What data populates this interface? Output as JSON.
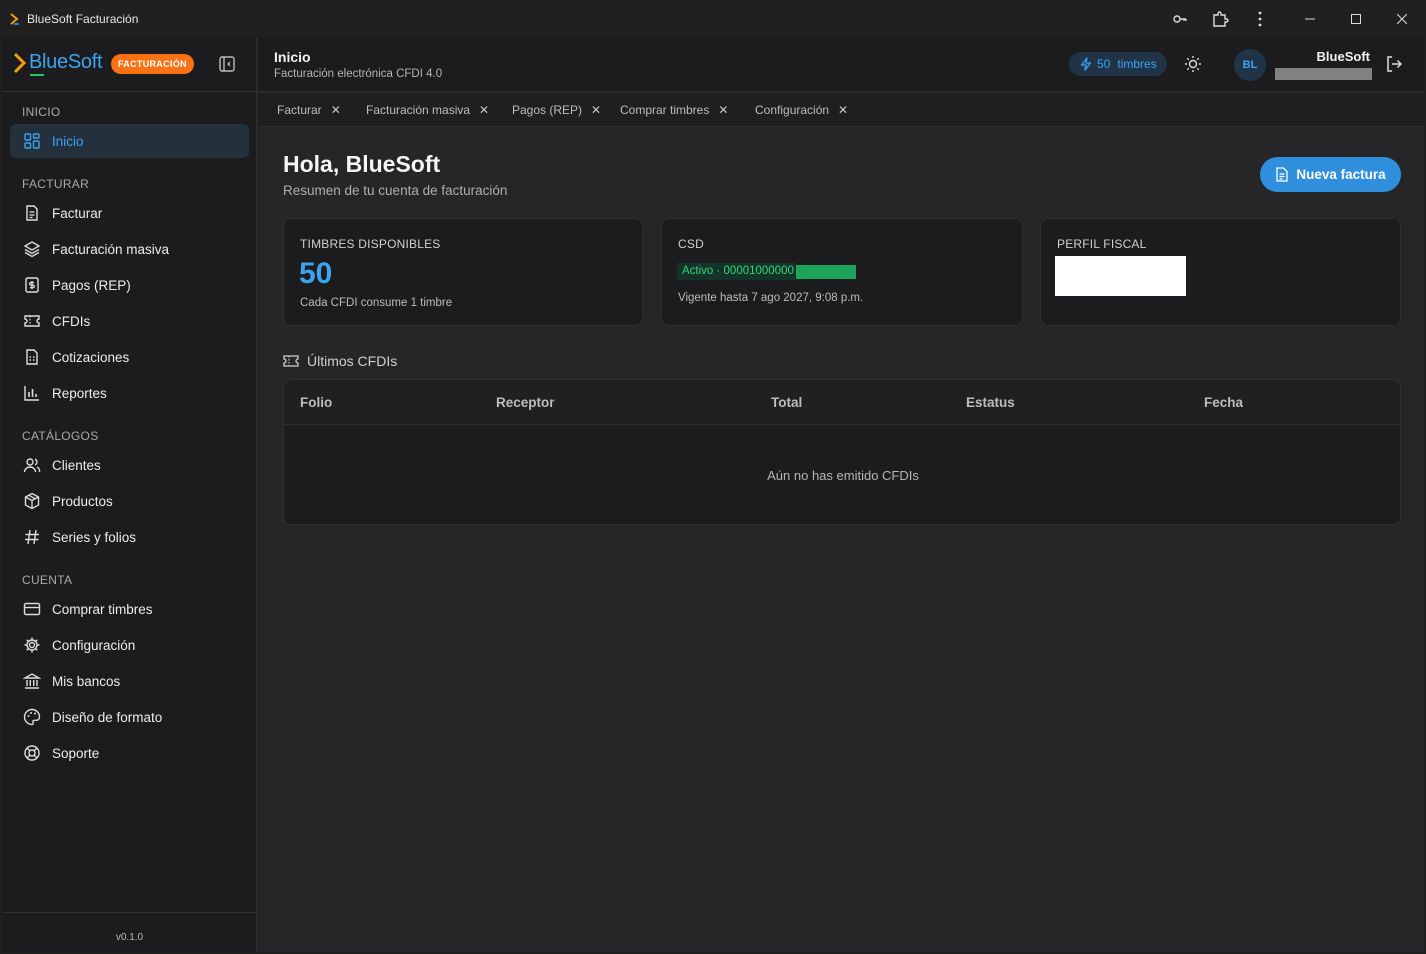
{
  "window": {
    "title": "BlueSoft Facturación"
  },
  "brand": {
    "name": "BlueSoft",
    "badge": "FACTURACIÓN"
  },
  "sidebar": {
    "sections": [
      {
        "title": "INICIO",
        "items": [
          {
            "label": "Inicio",
            "icon": "grid-icon",
            "active": true
          }
        ]
      },
      {
        "title": "FACTURAR",
        "items": [
          {
            "label": "Facturar",
            "icon": "document-icon"
          },
          {
            "label": "Facturación masiva",
            "icon": "layers-icon"
          },
          {
            "label": "Pagos (REP)",
            "icon": "dollar-document-icon"
          },
          {
            "label": "CFDIs",
            "icon": "ticket-icon"
          },
          {
            "label": "Cotizaciones",
            "icon": "calculator-icon"
          },
          {
            "label": "Reportes",
            "icon": "bar-chart-icon"
          }
        ]
      },
      {
        "title": "CATÁLOGOS",
        "items": [
          {
            "label": "Clientes",
            "icon": "users-icon"
          },
          {
            "label": "Productos",
            "icon": "package-icon"
          },
          {
            "label": "Series y folios",
            "icon": "hash-icon"
          }
        ]
      },
      {
        "title": "CUENTA",
        "items": [
          {
            "label": "Comprar timbres",
            "icon": "credit-card-icon"
          },
          {
            "label": "Configuración",
            "icon": "gear-icon"
          },
          {
            "label": "Mis bancos",
            "icon": "bank-icon"
          },
          {
            "label": "Diseño de formato",
            "icon": "palette-icon"
          },
          {
            "label": "Soporte",
            "icon": "lifebuoy-icon"
          }
        ]
      }
    ],
    "version": "v0.1.0"
  },
  "header": {
    "title": "Inicio",
    "subtitle": "Facturación electrónica CFDI 4.0",
    "stamps_count": "50",
    "stamps_label": "timbres",
    "avatar": "BL",
    "user_name": "BlueSoft"
  },
  "tabs": [
    "Facturar",
    "Facturación masiva",
    "Pagos (REP)",
    "Comprar timbres",
    "Configuración"
  ],
  "main": {
    "greeting": "Hola, BlueSoft",
    "greeting_sub": "Resumen de tu cuenta de facturación",
    "new_invoice_label": "Nueva factura",
    "cards": {
      "stamps": {
        "title": "TIMBRES DISPONIBLES",
        "value": "50",
        "note": "Cada CFDI consume 1 timbre"
      },
      "csd": {
        "title": "CSD",
        "status": "Activo · 00001000000",
        "valid": "Vigente hasta 7 ago 2027, 9:08 p.m."
      },
      "fiscal": {
        "title": "PERFIL FISCAL"
      }
    },
    "latest": {
      "title": "Últimos CFDIs",
      "columns": [
        "Folio",
        "Receptor",
        "Total",
        "Estatus",
        "Fecha"
      ],
      "empty": "Aún no has emitido CFDIs"
    }
  },
  "colors": {
    "accent": "#3ba3f0",
    "badge": "#f97316",
    "success": "#34d27b"
  }
}
